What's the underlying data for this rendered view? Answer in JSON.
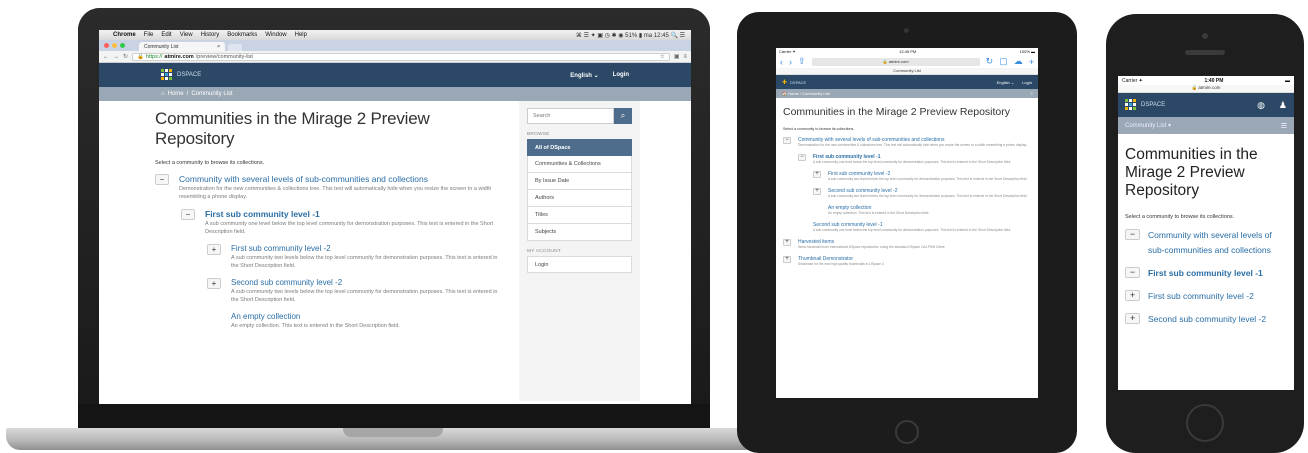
{
  "colors": {
    "navbar": "#2b4966",
    "trail": "#9aa7b5",
    "link": "#2a6ea6",
    "sidebar_active": "#4e6d8c",
    "device_black": "#1e1e1e",
    "laptop_silver": "#c4c4c4"
  },
  "laptop": {
    "menubar": {
      "apple_icon": "apple-icon",
      "items": [
        "Chrome",
        "File",
        "Edit",
        "View",
        "History",
        "Bookmarks",
        "Window",
        "Help"
      ],
      "right_text": "⌘ ☰ ✦ ▣ ◷ ✱ ◉ 51% ▮ ma 12:45  🔍 ☰"
    },
    "tab_title": "Community List",
    "url": {
      "scheme": "https://",
      "host": "atmire.com",
      "path": "/preview/community-list"
    },
    "nav": {
      "brand": "DSPACE",
      "language": "English ⌄",
      "login": "Login"
    },
    "trail": {
      "home_icon": "home-icon",
      "home": "Home",
      "sep": "/",
      "current": "Community List"
    },
    "page_title": "Communities in the Mirage 2 Preview Repository",
    "intro": "Select a community to browse its collections.",
    "tree": [
      {
        "toggle": "−",
        "title": "Community with several levels of sub-communities and collections",
        "desc": "Demonstration for the new communities & collections tree. This text will automatically hide when you resize the screen to a width resembling a phone display."
      },
      {
        "toggle": "−",
        "title": "First sub community level -1",
        "desc": "A sub community one level below the top level community for demonstration purposes. This text is entered in the Short Description field."
      },
      {
        "toggle": "+",
        "title": "First sub community level -2",
        "desc": "A sub community two levels below the top level community for demonstration purposes. This text is entered in the Short Description field."
      },
      {
        "toggle": "+",
        "title": "Second sub community level -2",
        "desc": "A sub community two levels below the top level community for demonstration purposes. This text is entered in the Short Description field."
      },
      {
        "toggle": "",
        "title": "An empty collection",
        "desc": "An empty collection. This text is entered in the Short Description field."
      }
    ],
    "sidebar": {
      "search_placeholder": "Search",
      "search_icon": "search-icon",
      "browse_header": "BROWSE",
      "browse_items": [
        "All of DSpace",
        "Communities & Collections",
        "By Issue Date",
        "Authors",
        "Titles",
        "Subjects"
      ],
      "account_header": "MY ACCOUNT",
      "account_items": [
        "Login"
      ]
    }
  },
  "tablet": {
    "status": {
      "carrier": "Carrier ✦",
      "time": "12:45 PM",
      "battery": "100% ▬"
    },
    "url": "🔒 atmire.com",
    "page_tab_title": "Community List",
    "nav": {
      "brand": "DSPACE",
      "language": "English ⌄",
      "login": "Login"
    },
    "trail": "🏠 Home / Community List",
    "page_title": "Communities in the Mirage 2 Preview Repository",
    "intro": "Select a community to browse its collections.",
    "tree": [
      {
        "toggle": "−",
        "title": "Community with several levels of sub-communities and collections",
        "desc": "Demonstration for the new communities & collections tree. This text will automatically hide when you resize the screen to a width resembling a phone display."
      },
      {
        "toggle": "−",
        "title": "First sub community level -1",
        "desc": "A sub community one level below the top level community for demonstration purposes. This text is entered in the Short Description field."
      },
      {
        "toggle": "+",
        "title": "First sub community level -2",
        "desc": "A sub community two levels below the top level community for demonstration purposes. This text is entered in the Short Description field."
      },
      {
        "toggle": "+",
        "title": "Second sub community level -2",
        "desc": "A sub community two levels below the top level community for demonstration purposes. This text is entered in the Short Description field."
      },
      {
        "toggle": "",
        "title": "An empty collection",
        "desc": "An empty collection. This text is entered in the Short Description field."
      },
      {
        "toggle": "",
        "title": "Second sub community level -1",
        "desc": "A sub community one level below the top level community for demonstration purposes. This text is entered in the Short Description field."
      },
      {
        "toggle": "+",
        "title": "Harvested items",
        "desc": "Items harvested from international DSpace repositories, using the standard DSpace OAI-PMH Client."
      },
      {
        "toggle": "+",
        "title": "Thumbnail Demonstrator",
        "desc": "Showcase for the new high quality thumbnails in DSpace 4"
      }
    ]
  },
  "phone": {
    "status": {
      "carrier": "Carrier ✦",
      "time": "1:40 PM",
      "battery": "▬"
    },
    "url": "🔒 atmire.com",
    "nav": {
      "brand": "DSPACE",
      "globe_icon": "globe-icon",
      "user_icon": "user-icon"
    },
    "trail": {
      "label": "Community List ▾",
      "menu_icon": "menu-icon"
    },
    "page_title": "Communities in the Mirage 2 Preview Repository",
    "intro": "Select a community to browse its collections.",
    "tree": [
      {
        "toggle": "−",
        "title": "Community with several levels of sub-communities and collections"
      },
      {
        "toggle": "−",
        "title": "First sub community level -1"
      },
      {
        "toggle": "+",
        "title": "First sub community level -2"
      },
      {
        "toggle": "+",
        "title": "Second sub community level -2"
      }
    ]
  }
}
